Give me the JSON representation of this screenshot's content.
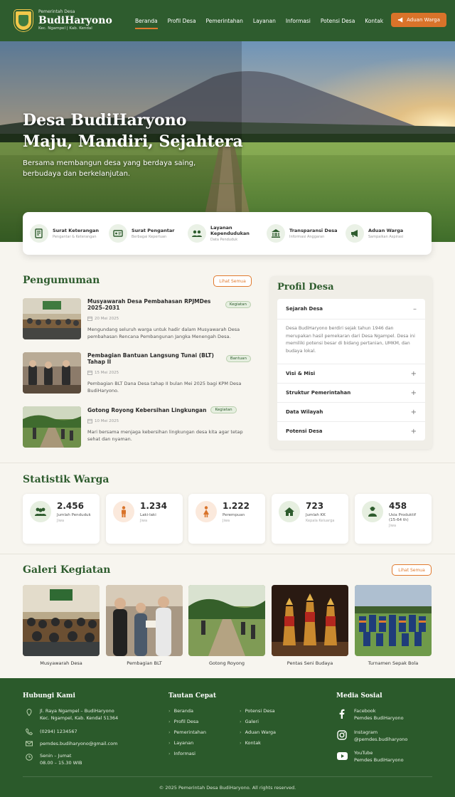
{
  "header": {
    "subtitle": "Pemerintah Desa",
    "name": "BudiHaryono",
    "location": "Kec. Ngampel | Kab. Kendal",
    "nav": [
      "Beranda",
      "Profil Desa",
      "Pemerintahan",
      "Layanan",
      "Informasi",
      "Potensi Desa",
      "Kontak"
    ],
    "active_nav": "Beranda",
    "aduan_button": "Aduan Warga"
  },
  "hero": {
    "title_line1": "Desa BudiHaryono",
    "title_line2": "Maju, Mandiri, Sejahtera",
    "subtitle": "Bersama membangun desa yang berdaya saing, berbudaya dan berkelanjutan."
  },
  "services": [
    {
      "title": "Surat Keterangan",
      "sub": "Pengantar & Keterangan",
      "icon": "document-icon"
    },
    {
      "title": "Surat Pengantar",
      "sub": "Berbagai Keperluan",
      "icon": "id-card-icon"
    },
    {
      "title": "Layanan Kependudukan",
      "sub": "Data Penduduk",
      "icon": "people-icon"
    },
    {
      "title": "Transparansi Desa",
      "sub": "Informasi Anggaran",
      "icon": "building-icon"
    },
    {
      "title": "Aduan Warga",
      "sub": "Sampaikan Aspirasi",
      "icon": "megaphone-icon"
    }
  ],
  "pengumuman": {
    "title": "Pengumuman",
    "see_all": "Lihat Semua",
    "items": [
      {
        "title": "Musyawarah Desa Pembahasan RPJMDes 2025–2031",
        "tag": "Kegiatan",
        "date": "20 Mei 2025",
        "desc": "Mengundang seluruh warga untuk hadir dalam Musyawarah Desa pembahasan Rencana Pembangunan Jangka Menengah Desa."
      },
      {
        "title": "Pembagian Bantuan Langsung Tunai (BLT) Tahap II",
        "tag": "Bantuan",
        "date": "15 Mei 2025",
        "desc": "Pembagian BLT Dana Desa tahap II bulan Mei 2025 bagi KPM Desa BudiHaryono."
      },
      {
        "title": "Gotong Royong Kebersihan Lingkungan",
        "tag": "Kegiatan",
        "date": "10 Mei 2025",
        "desc": "Mari bersama menjaga kebersihan lingkungan desa kita agar tetap sehat dan nyaman."
      }
    ]
  },
  "profil": {
    "title": "Profil Desa",
    "open_item": "Sejarah Desa",
    "open_content": "Desa BudiHaryono berdiri sejak tahun 1946 dan merupakan hasil pemekaran dari Desa Ngampel. Desa ini memiliki potensi besar di bidang pertanian, UMKM, dan budaya lokal.",
    "items": [
      "Visi & Misi",
      "Struktur Pemerintahan",
      "Data Wilayah",
      "Potensi Desa"
    ]
  },
  "statistik": {
    "title": "Statistik Warga",
    "items": [
      {
        "value": "2.456",
        "label": "Jumlah Penduduk",
        "unit": "Jiwa",
        "icon": "people-icon",
        "color": "#2e5c2e",
        "bg": "#e6efe0"
      },
      {
        "value": "1.234",
        "label": "Laki-laki",
        "unit": "Jiwa",
        "icon": "male-icon",
        "color": "#d9732a",
        "bg": "#fbe9dc"
      },
      {
        "value": "1.222",
        "label": "Perempuan",
        "unit": "Jiwa",
        "icon": "female-icon",
        "color": "#d9732a",
        "bg": "#fbe9dc"
      },
      {
        "value": "723",
        "label": "Jumlah KK",
        "unit": "Kepala Keluarga",
        "icon": "house-icon",
        "color": "#2e5c2e",
        "bg": "#e6efe0"
      },
      {
        "value": "458",
        "label": "Usia Produktif (15-64 th)",
        "unit": "Jiwa",
        "icon": "worker-icon",
        "color": "#2e5c2e",
        "bg": "#e6efe0"
      }
    ]
  },
  "galeri": {
    "title": "Galeri Kegiatan",
    "see_all": "Lihat Semua",
    "items": [
      "Musyawarah Desa",
      "Pembagian BLT",
      "Gotong Royong",
      "Pentas Seni Budaya",
      "Turnamen Sepak Bola"
    ]
  },
  "footer": {
    "contact_title": "Hubungi Kami",
    "address1": "Jl. Raya Ngampel – BudiHaryono",
    "address2": "Kec. Ngampel, Kab. Kendal 51364",
    "phone": "(0294) 1234567",
    "email": "pemdes.budiharyono@gmail.com",
    "hours1": "Senin – Jumat",
    "hours2": "08.00 – 15.30 WIB",
    "links_title": "Tautan Cepat",
    "links_col1": [
      "Beranda",
      "Profil Desa",
      "Pemerintahan",
      "Layanan",
      "Informasi"
    ],
    "links_col2": [
      "Potensi Desa",
      "Galeri",
      "Aduan Warga",
      "Kontak"
    ],
    "social_title": "Media Sosial",
    "social": [
      {
        "name": "Facebook",
        "handle": "Pemdes BudiHaryono",
        "icon": "facebook-icon"
      },
      {
        "name": "Instagram",
        "handle": "@pemdes.budiharyono",
        "icon": "instagram-icon"
      },
      {
        "name": "YouTube",
        "handle": "Pemdes BudiHaryono",
        "icon": "youtube-icon"
      }
    ],
    "copyright": "© 2025 Pemerintah Desa BudiHaryono. All rights reserved."
  }
}
